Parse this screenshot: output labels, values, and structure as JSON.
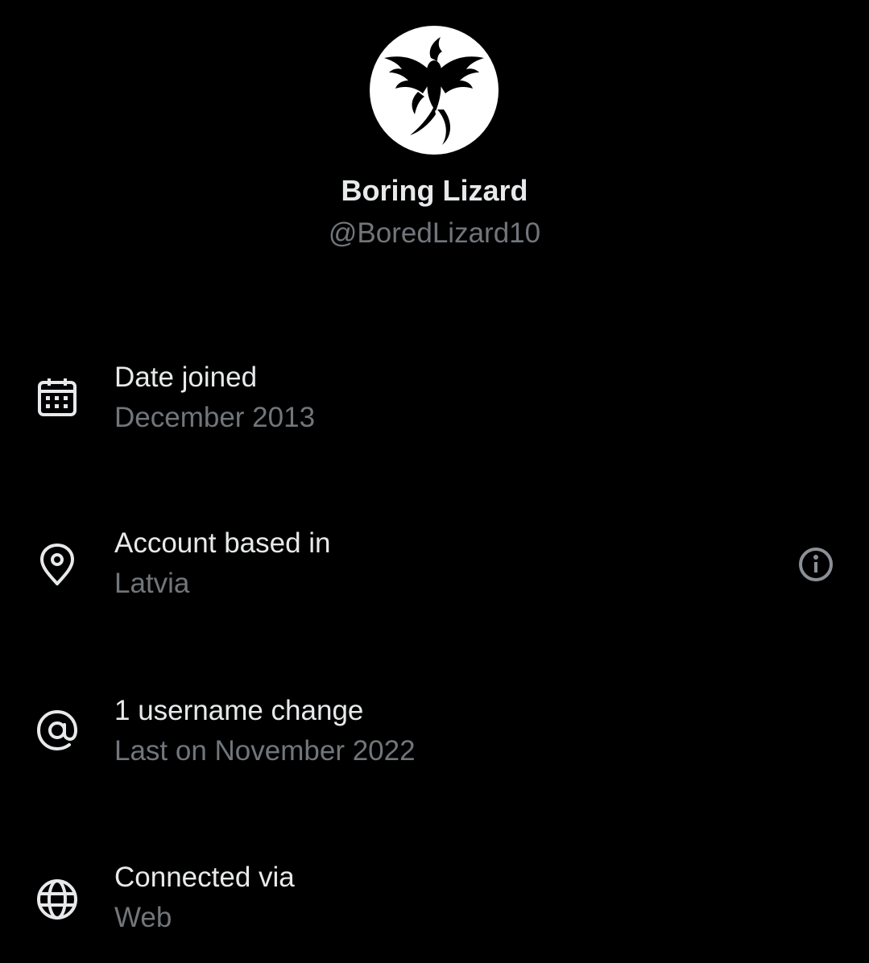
{
  "profile": {
    "display_name": "Boring Lizard",
    "handle": "@BoredLizard10",
    "avatar_icon": "phoenix-icon"
  },
  "rows": [
    {
      "icon": "calendar-icon",
      "title": "Date joined",
      "value": "December 2013"
    },
    {
      "icon": "location-pin-icon",
      "title": "Account based in",
      "value": "Latvia",
      "action_icon": "info-icon"
    },
    {
      "icon": "at-sign-icon",
      "title": "1 username change",
      "value": "Last on November 2022"
    },
    {
      "icon": "globe-icon",
      "title": "Connected via",
      "value": "Web"
    }
  ],
  "colors": {
    "background": "#000000",
    "primary_text": "#e7e9ea",
    "secondary_text": "#71767b"
  }
}
